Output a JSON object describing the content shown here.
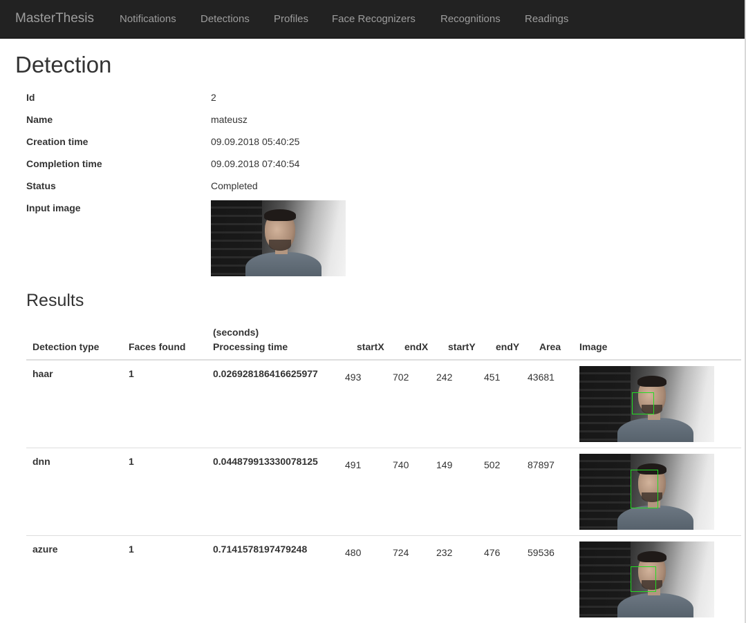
{
  "navbar": {
    "brand": "MasterThesis",
    "links": [
      "Notifications",
      "Detections",
      "Profiles",
      "Face Recognizers",
      "Recognitions",
      "Readings"
    ]
  },
  "page_title": "Detection",
  "details": {
    "id_label": "Id",
    "id_value": "2",
    "name_label": "Name",
    "name_value": "mateusz",
    "creation_label": "Creation time",
    "creation_value": "09.09.2018 05:40:25",
    "completion_label": "Completion time",
    "completion_value": "09.09.2018 07:40:54",
    "status_label": "Status",
    "status_value": "Completed",
    "input_image_label": "Input image"
  },
  "results": {
    "title": "Results",
    "headers": {
      "detection_type": "Detection type",
      "faces_found": "Faces found",
      "processing_unit": "(seconds)",
      "processing_time": "Processing time",
      "start_x": "startX",
      "end_x": "endX",
      "start_y": "startY",
      "end_y": "endY",
      "area": "Area",
      "image": "Image"
    },
    "rows": [
      {
        "type": "haar",
        "faces": "1",
        "time": "0.026928186416625977",
        "startX": "493",
        "endX": "702",
        "startY": "242",
        "endY": "451",
        "area": "43681"
      },
      {
        "type": "dnn",
        "faces": "1",
        "time": "0.044879913330078125",
        "startX": "491",
        "endX": "740",
        "startY": "149",
        "endY": "502",
        "area": "87897"
      },
      {
        "type": "azure",
        "faces": "1",
        "time": "0.7141578197479248",
        "startX": "480",
        "endX": "724",
        "startY": "232",
        "endY": "476",
        "area": "59536"
      }
    ]
  }
}
